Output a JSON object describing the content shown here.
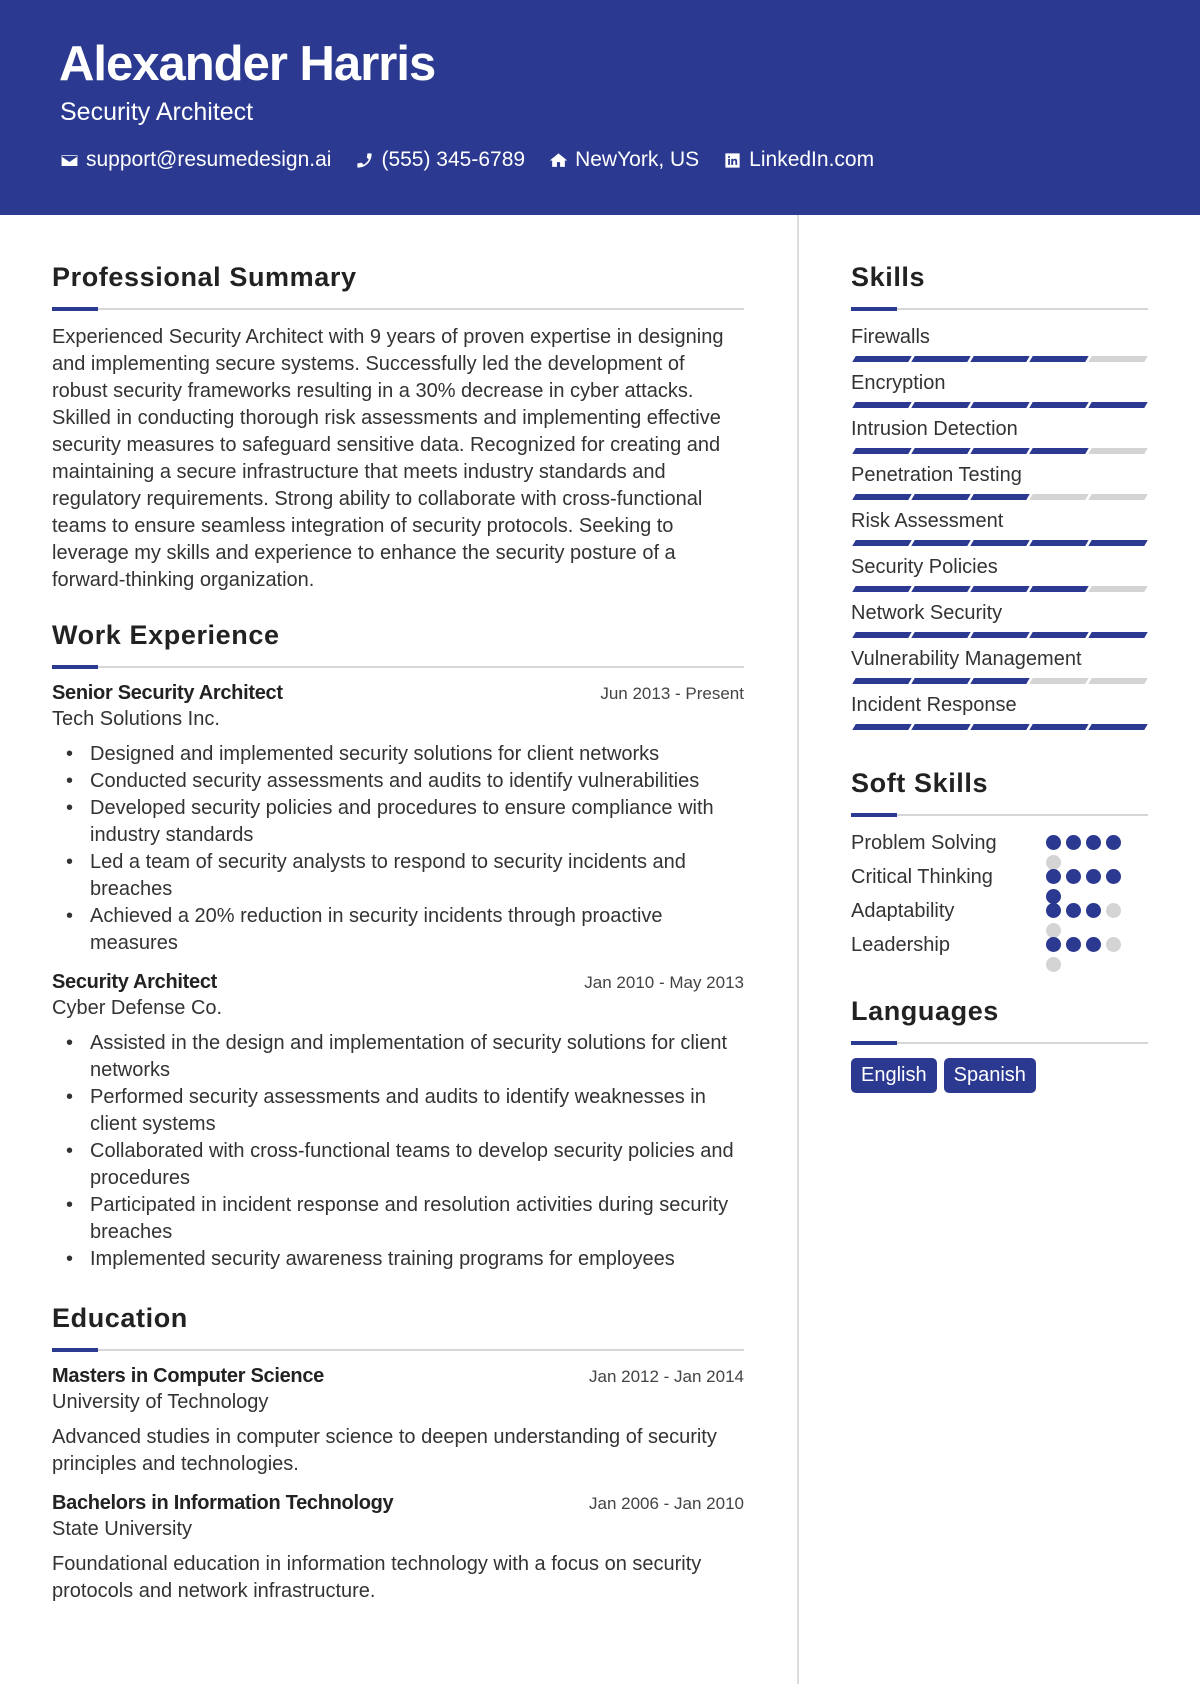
{
  "header": {
    "name": "Alexander Harris",
    "title": "Security Architect",
    "contacts": [
      {
        "icon": "envelope-icon",
        "text": "support@resumedesign.ai"
      },
      {
        "icon": "phone-icon",
        "text": "(555) 345-6789"
      },
      {
        "icon": "home-icon",
        "text": "NewYork, US"
      },
      {
        "icon": "linkedin-icon",
        "text": "LinkedIn.com"
      }
    ]
  },
  "summary": {
    "heading": "Professional Summary",
    "text": "Experienced Security Architect with 9 years of proven expertise in designing and implementing secure systems. Successfully led the development of robust security frameworks resulting in a 30% decrease in cyber attacks. Skilled in conducting thorough risk assessments and implementing effective security measures to safeguard sensitive data. Recognized for creating and maintaining a secure infrastructure that meets industry standards and regulatory requirements. Strong ability to collaborate with cross-functional teams to ensure seamless integration of security protocols. Seeking to leverage my skills and experience to enhance the security posture of a forward-thinking organization."
  },
  "experience": {
    "heading": "Work Experience",
    "jobs": [
      {
        "title": "Senior Security Architect",
        "company": "Tech Solutions Inc.",
        "dates": "Jun 2013 - Present",
        "bullets": [
          "Designed and implemented security solutions for client networks",
          "Conducted security assessments and audits to identify vulnerabilities",
          "Developed security policies and procedures to ensure compliance with industry standards",
          "Led a team of security analysts to respond to security incidents and breaches",
          "Achieved a 20% reduction in security incidents through proactive measures"
        ]
      },
      {
        "title": "Security Architect",
        "company": "Cyber Defense Co.",
        "dates": "Jan 2010 - May 2013",
        "bullets": [
          "Assisted in the design and implementation of security solutions for client networks",
          "Performed security assessments and audits to identify weaknesses in client systems",
          "Collaborated with cross-functional teams to develop security policies and procedures",
          "Participated in incident response and resolution activities during security breaches",
          "Implemented security awareness training programs for employees"
        ]
      }
    ]
  },
  "education": {
    "heading": "Education",
    "items": [
      {
        "degree": "Masters in Computer Science",
        "school": "University of Technology",
        "dates": "Jan 2012 - Jan 2014",
        "description": "Advanced studies in computer science to deepen understanding of security principles and technologies."
      },
      {
        "degree": "Bachelors in Information Technology",
        "school": "State University",
        "dates": "Jan 2006 - Jan 2010",
        "description": "Foundational education in information technology with a focus on security protocols and network infrastructure."
      }
    ]
  },
  "skills": {
    "heading": "Skills",
    "max_level": 5,
    "items": [
      {
        "name": "Firewalls",
        "level": 4
      },
      {
        "name": "Encryption",
        "level": 5
      },
      {
        "name": "Intrusion Detection",
        "level": 4
      },
      {
        "name": "Penetration Testing",
        "level": 3
      },
      {
        "name": "Risk Assessment",
        "level": 5
      },
      {
        "name": "Security Policies",
        "level": 4
      },
      {
        "name": "Network Security",
        "level": 5
      },
      {
        "name": "Vulnerability Management",
        "level": 3
      },
      {
        "name": "Incident Response",
        "level": 5
      }
    ]
  },
  "soft_skills": {
    "heading": "Soft Skills",
    "max_level": 5,
    "items": [
      {
        "name": "Problem Solving",
        "level": 4
      },
      {
        "name": "Critical Thinking",
        "level": 5
      },
      {
        "name": "Adaptability",
        "level": 3
      },
      {
        "name": "Leadership",
        "level": 3
      }
    ]
  },
  "languages": {
    "heading": "Languages",
    "items": [
      "English",
      "Spanish"
    ]
  },
  "colors": {
    "accent": "#2b3990",
    "inactive": "#d4d4d4"
  }
}
